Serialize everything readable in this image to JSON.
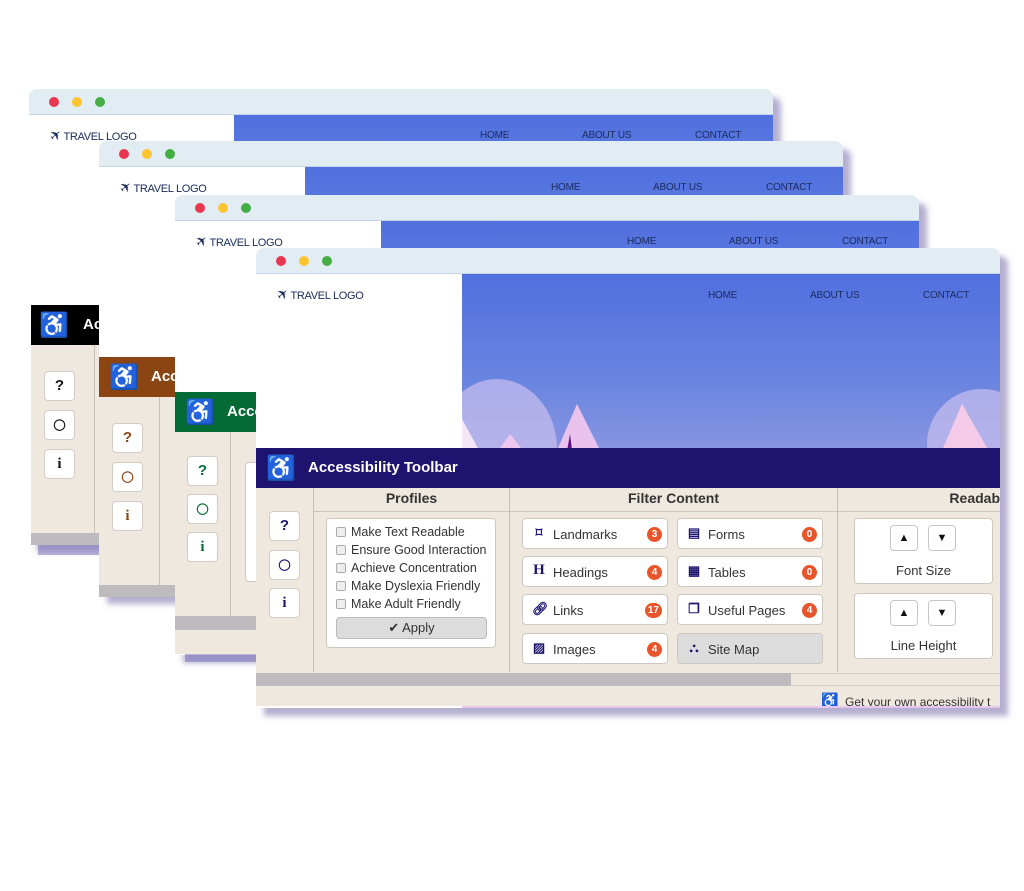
{
  "site": {
    "logo": "TRAVEL LOGO",
    "nav": [
      "HOME",
      "ABOUT US",
      "CONTACT"
    ]
  },
  "themes": [
    {
      "name": "black",
      "header_color": "#000000",
      "icon_color": "#111111"
    },
    {
      "name": "brown",
      "header_color": "#8b4513",
      "icon_color": "#8b4513"
    },
    {
      "name": "green",
      "header_color": "#046b35",
      "icon_color": "#046b35"
    },
    {
      "name": "indigo",
      "header_color": "#1e1470",
      "icon_color": "#1e1470"
    }
  ],
  "toolbar": {
    "title": "Accessibility Toolbar",
    "title_truncated": [
      "Ac",
      "Acc",
      "Acce"
    ],
    "side_buttons": [
      {
        "icon": "question-icon",
        "glyph": "?"
      },
      {
        "icon": "speech-bubble-icon",
        "glyph": "💬"
      },
      {
        "icon": "info-icon",
        "glyph": "i"
      }
    ],
    "sections": {
      "profiles": "Profiles",
      "filter": "Filter Content",
      "readability": "Readab"
    },
    "profiles": [
      {
        "label": "Make Text Readable",
        "checked": false
      },
      {
        "label": "Ensure Good Interaction",
        "checked": false
      },
      {
        "label": "Achieve Concentration",
        "checked": false
      },
      {
        "label": "Make Dyslexia Friendly",
        "checked": false
      },
      {
        "label": "Make Adult Friendly",
        "checked": false
      }
    ],
    "apply_label": "Apply",
    "filters": [
      {
        "label": "Landmarks",
        "count": "3",
        "icon": "bookmark-icon"
      },
      {
        "label": "Forms",
        "count": "0",
        "icon": "form-icon"
      },
      {
        "label": "Headings",
        "count": "4",
        "icon": "heading-icon"
      },
      {
        "label": "Tables",
        "count": "0",
        "icon": "table-icon"
      },
      {
        "label": "Links",
        "count": "17",
        "icon": "link-icon"
      },
      {
        "label": "Useful Pages",
        "count": "4",
        "icon": "pages-icon"
      },
      {
        "label": "Images",
        "count": "4",
        "icon": "image-icon"
      },
      {
        "label": "Site Map",
        "count": null,
        "icon": "sitemap-icon"
      }
    ],
    "readability": [
      {
        "label": "Font Size"
      },
      {
        "label": "Line Height"
      }
    ],
    "footer_text": "Get your own accessibility t",
    "badge_color": "#e8552a"
  }
}
